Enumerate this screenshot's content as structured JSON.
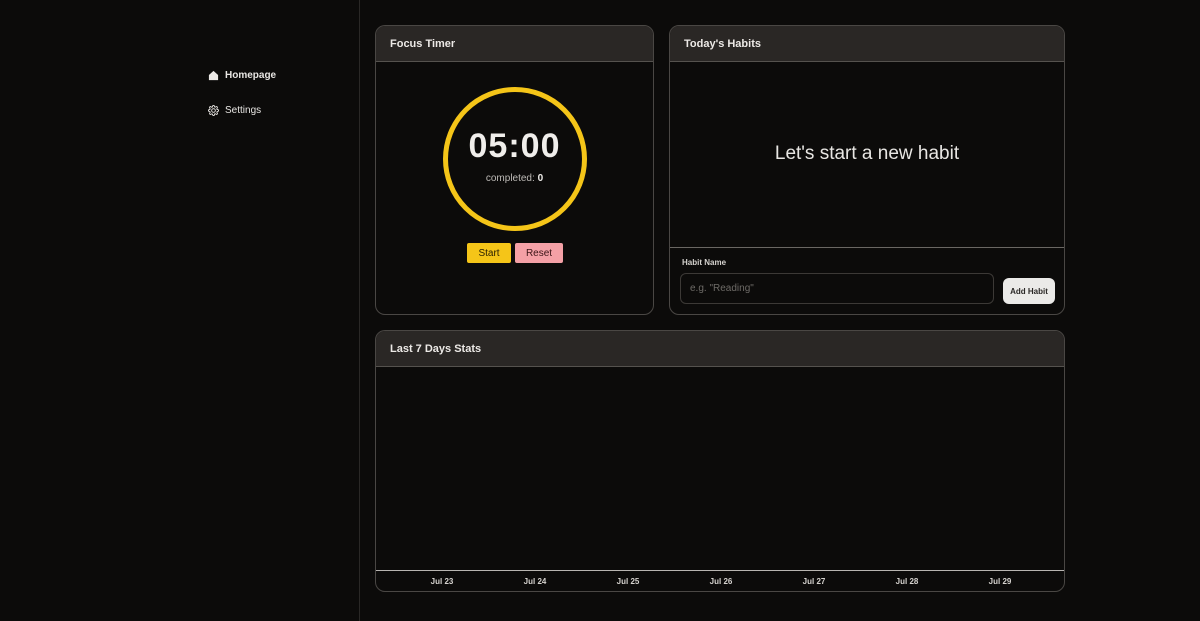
{
  "sidebar": {
    "items": [
      {
        "label": "Homepage",
        "icon": "home-icon",
        "active": true
      },
      {
        "label": "Settings",
        "icon": "gear-icon",
        "active": false
      }
    ]
  },
  "timer": {
    "title": "Focus Timer",
    "time": "05:00",
    "completed_label": "completed:",
    "completed_count": "0",
    "start_label": "Start",
    "reset_label": "Reset",
    "ring_color": "#f5c518"
  },
  "habits": {
    "title": "Today's Habits",
    "empty_message": "Let's start a new habit",
    "field_label": "Habit Name",
    "input_placeholder": "e.g. \"Reading\"",
    "input_value": "",
    "add_label": "Add Habit"
  },
  "stats": {
    "title": "Last 7 Days Stats",
    "days": [
      "Jul 23",
      "Jul 24",
      "Jul 25",
      "Jul 26",
      "Jul 27",
      "Jul 28",
      "Jul 29"
    ]
  },
  "colors": {
    "background": "#0c0b0a",
    "card_header": "#2a2725",
    "accent_yellow": "#f5c518",
    "reset_pink": "#f4a0a6"
  }
}
